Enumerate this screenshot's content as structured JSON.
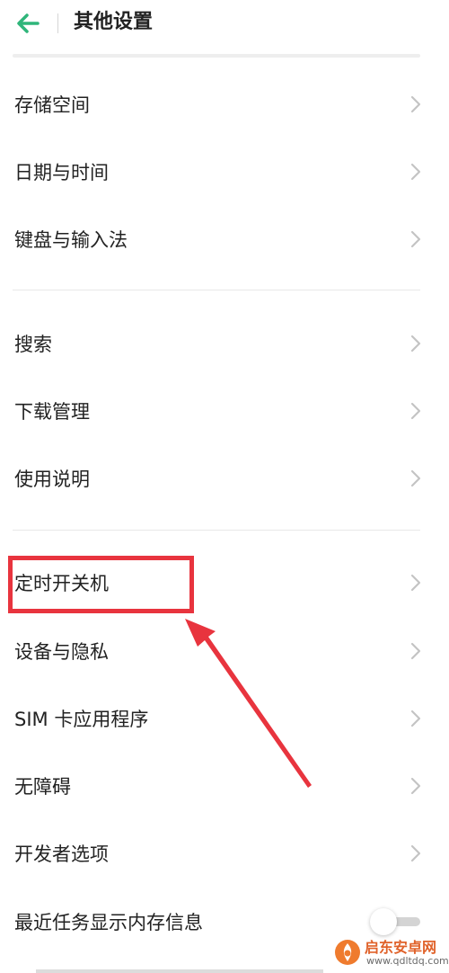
{
  "header": {
    "title": "其他设置",
    "back_icon": "arrow-left-icon",
    "accent": "#2fb57a"
  },
  "sections": [
    {
      "items": [
        {
          "label": "存储空间"
        },
        {
          "label": "日期与时间"
        },
        {
          "label": "键盘与输入法"
        }
      ]
    },
    {
      "items": [
        {
          "label": "搜索"
        },
        {
          "label": "下载管理"
        },
        {
          "label": "使用说明"
        }
      ]
    },
    {
      "items": [
        {
          "label": "定时开关机"
        },
        {
          "label": "设备与隐私"
        },
        {
          "label": "SIM 卡应用程序"
        },
        {
          "label": "无障碍"
        },
        {
          "label": "开发者选项"
        },
        {
          "label": "最近任务显示内存信息",
          "toggle": false
        }
      ]
    }
  ],
  "annotation": {
    "color": "#e8343e",
    "target": "定时开关机"
  },
  "watermark": {
    "text": "启东安卓网",
    "url": "www.qdltdq.com"
  }
}
